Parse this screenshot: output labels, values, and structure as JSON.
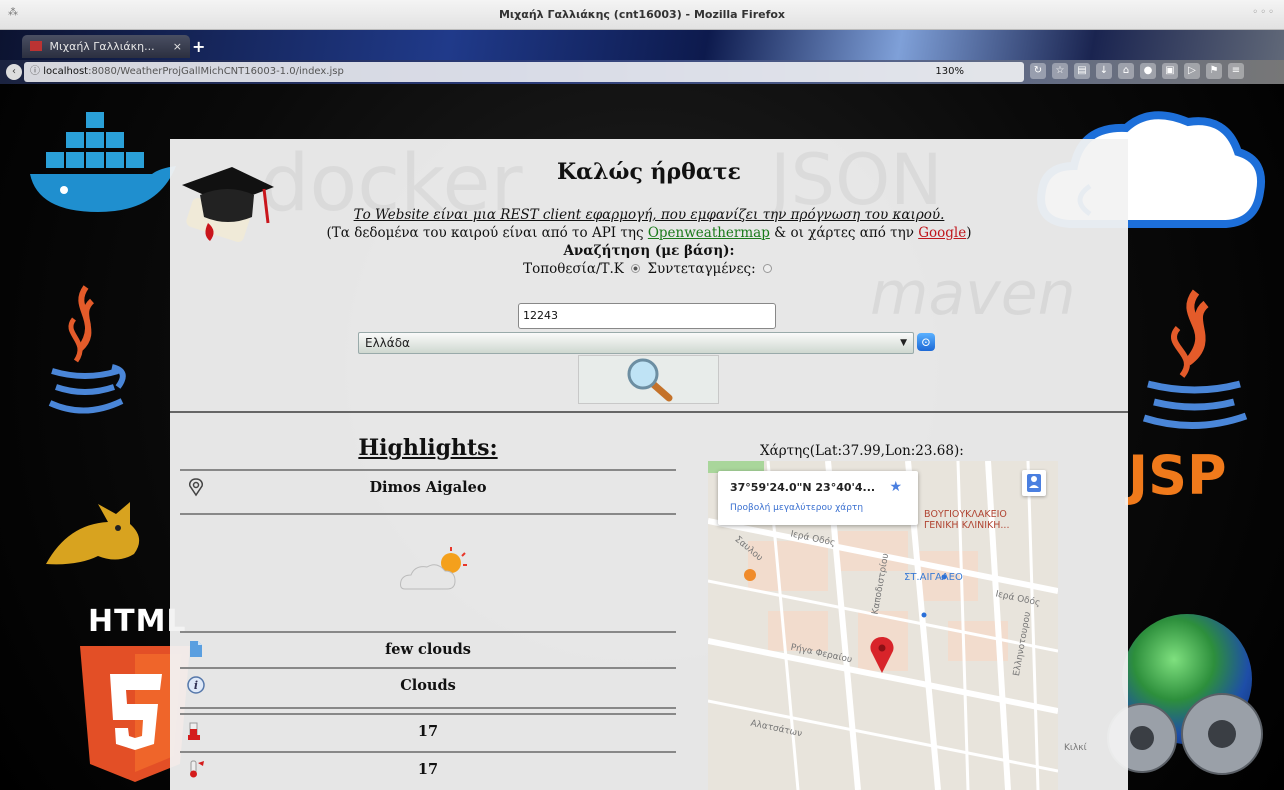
{
  "window": {
    "title": "Μιχαήλ Γαλλιάκης (cnt16003) - Mozilla Firefox"
  },
  "browser": {
    "tab_title": "Μιχαήλ Γαλλιάκη...",
    "tab_close": "×",
    "new_tab": "+",
    "url_host": "localhost",
    "url_rest": ":8080/WeatherProjGallMichCNT16003-1.0/index.jsp",
    "zoom": "130%"
  },
  "background": {
    "html_label": "HTML",
    "jsp_label": "JSP"
  },
  "page": {
    "welcome": "Καλώς ήρθατε",
    "intro": "Το Website είναι μια REST client εφαρμογή, που εμφανίζει την πρόγνωση του καιρού.",
    "intro2_prefix": "(Τα δεδομένα του καιρού είναι από το API της ",
    "openweathermap": "Openweathermap",
    "intro2_middle": " & οι χάρτες από την ",
    "google": "Google",
    "intro2_suffix": ")",
    "search_by": "Αναζήτηση (με βάση):",
    "radio_location": "Τοποθεσία/Τ.Κ",
    "radio_coords": "Συντεταγμένες:",
    "radio_selected": "location"
  },
  "search": {
    "zip_value": "12243",
    "country_value": "Ελλάδα"
  },
  "highlights": {
    "title": "Highlights:",
    "location": "Dimos Aigaleo",
    "description": "few clouds",
    "main": "Clouds",
    "temp": "17",
    "temp_feel": "17"
  },
  "map": {
    "title": "Χάρτης(Lat:37.99,Lon:23.68):",
    "coordinates": "37°59'24.0\"N 23°40'4...",
    "larger_map": "Προβολή μεγαλύτερου χάρτη",
    "hospital": "ΒΟΥΓΙΟΥΚΛΑΚΕΙΟ\nΓΕΝΙΚΗ ΚΛΙΝΙΚΗ...",
    "metro": "ΣΤ.ΑΙΓΑΛΕΟ",
    "street_1": "Ιερά Οδός",
    "street_2": "Ρήγα Φεραίου",
    "street_3": "Αλατσάτων",
    "street_4": "Ιερά Οδός",
    "street_5": "Καποδιστρίου",
    "street_6": "Ελληνοτουρου",
    "street_7": "Σαυλου",
    "street_8": "Κιλκί"
  },
  "colors": {
    "accent_link": "#1a7a1a",
    "google_link": "#c0161c",
    "panel_bg": "#f2f2f2",
    "map_pin": "#d8242a"
  }
}
